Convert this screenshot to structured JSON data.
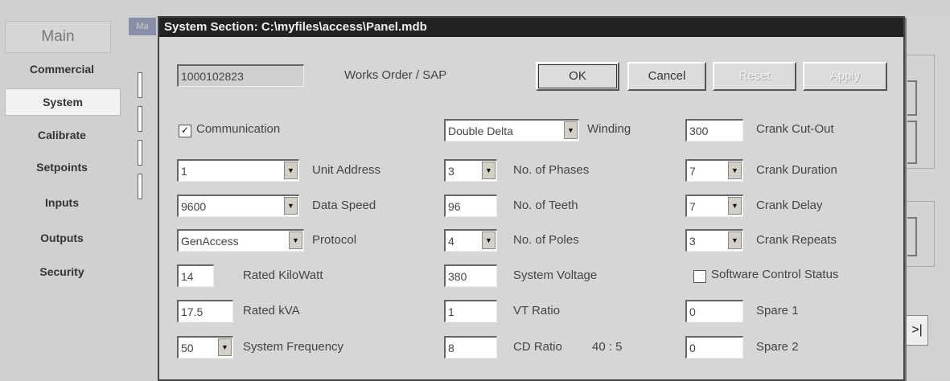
{
  "sidebar": {
    "title": "Main",
    "items": [
      {
        "label": "Commercial"
      },
      {
        "label": "System",
        "selected": true
      },
      {
        "label": "Calibrate"
      },
      {
        "label": "Setpoints"
      },
      {
        "label": "Inputs"
      },
      {
        "label": "Outputs"
      },
      {
        "label": "Security"
      }
    ]
  },
  "background": {
    "mdi_icon_label": "Ma",
    "scroll_arrow": ">|"
  },
  "dialog": {
    "title": "System Section: C:\\myfiles\\access\\Panel.mdb",
    "works_order_value": "1000102823",
    "works_order_label": "Works Order / SAP",
    "buttons": {
      "ok": "OK",
      "cancel": "Cancel",
      "reset": "Reset",
      "apply": "Apply"
    },
    "communication_label": "Communication",
    "communication_checked": true,
    "software_control_label": "Software Control Status",
    "software_control_checked": false,
    "col1": {
      "unit_address": {
        "value": "1",
        "label": "Unit Address"
      },
      "data_speed": {
        "value": "9600",
        "label": "Data Speed"
      },
      "protocol": {
        "value": "GenAccess",
        "label": "Protocol"
      },
      "rated_kw": {
        "value": "14",
        "label": "Rated KiloWatt"
      },
      "rated_kva": {
        "value": "17.5",
        "label": "Rated kVA"
      },
      "system_frequency": {
        "value": "50",
        "label": "System Frequency"
      }
    },
    "col2": {
      "winding": {
        "value": "Double Delta",
        "label": "Winding"
      },
      "phases": {
        "value": "3",
        "label": "No. of Phases"
      },
      "teeth": {
        "value": "96",
        "label": "No. of Teeth"
      },
      "poles": {
        "value": "4",
        "label": "No. of Poles"
      },
      "system_voltage": {
        "value": "380",
        "label": "System Voltage"
      },
      "vt_ratio": {
        "value": "1",
        "label": "VT Ratio"
      },
      "cd_ratio": {
        "value": "8",
        "label": "CD Ratio",
        "ratio_text": "40 : 5"
      }
    },
    "col3": {
      "crank_cutout": {
        "value": "300",
        "label": "Crank Cut-Out"
      },
      "crank_duration": {
        "value": "7",
        "label": "Crank Duration"
      },
      "crank_delay": {
        "value": "7",
        "label": "Crank Delay"
      },
      "crank_repeats": {
        "value": "3",
        "label": "Crank Repeats"
      },
      "spare1": {
        "value": "0",
        "label": "Spare 1"
      },
      "spare2": {
        "value": "0",
        "label": "Spare 2"
      }
    },
    "combo_arrow": "▼"
  }
}
